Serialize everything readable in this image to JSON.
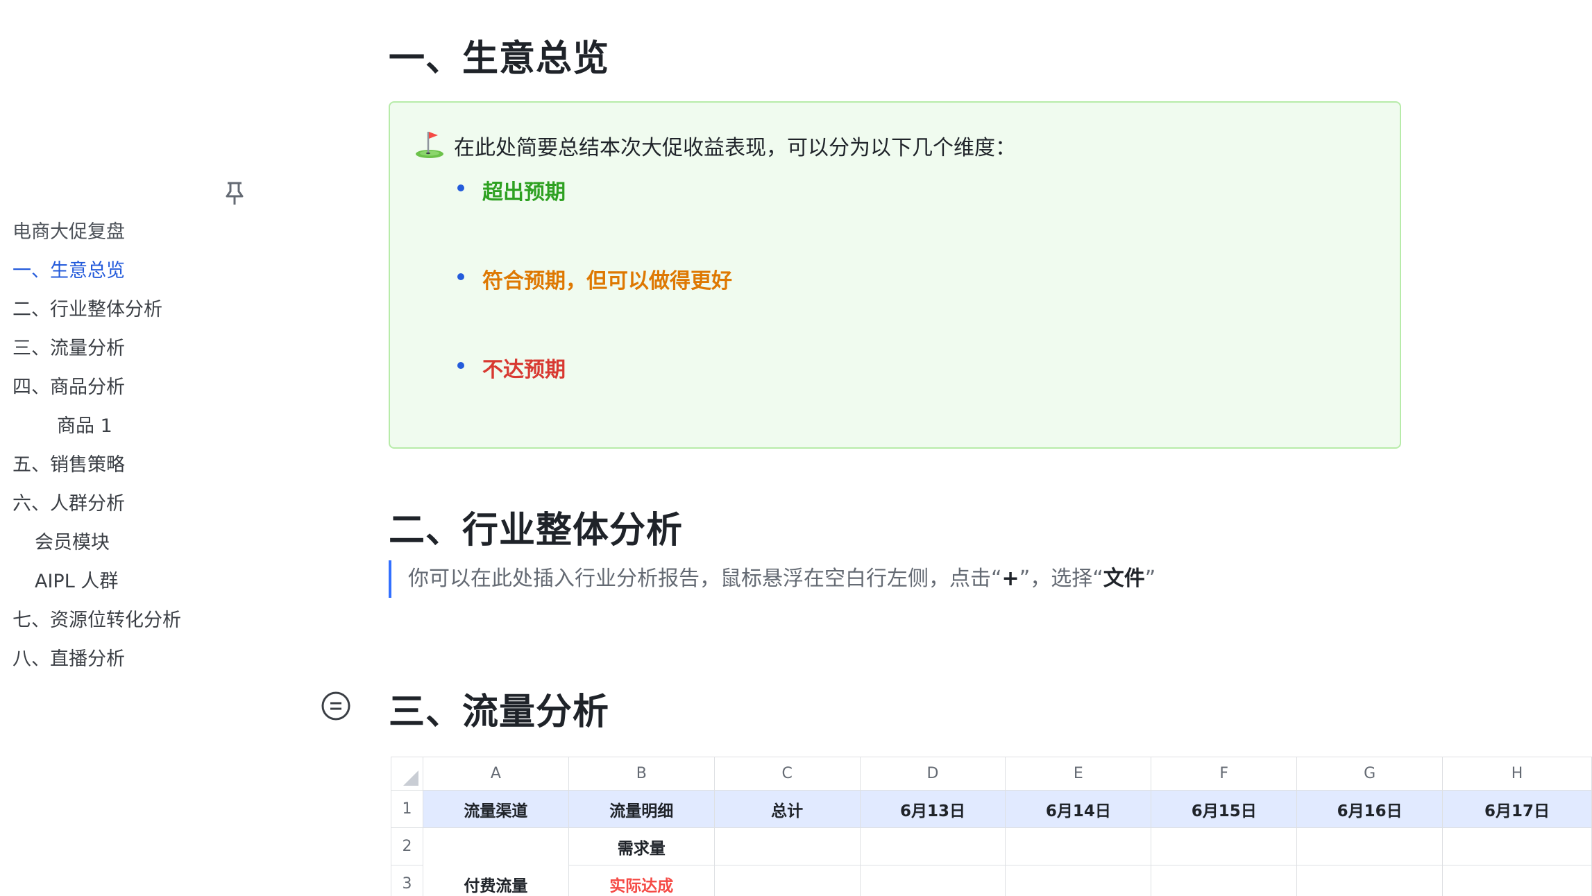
{
  "sidebar": {
    "items": [
      {
        "label": "电商大促复盘",
        "level": 0,
        "kind": "title"
      },
      {
        "label": "一、生意总览",
        "level": 0,
        "kind": "active"
      },
      {
        "label": "二、行业整体分析",
        "level": 0,
        "kind": "normal"
      },
      {
        "label": "三、流量分析",
        "level": 0,
        "kind": "normal"
      },
      {
        "label": "四、商品分析",
        "level": 0,
        "kind": "normal"
      },
      {
        "label": "商品 1",
        "level": 2,
        "kind": "normal"
      },
      {
        "label": "五、销售策略",
        "level": 0,
        "kind": "normal"
      },
      {
        "label": "六、人群分析",
        "level": 0,
        "kind": "normal"
      },
      {
        "label": "会员模块",
        "level": 1,
        "kind": "normal"
      },
      {
        "label": "AIPL 人群",
        "level": 1,
        "kind": "normal"
      },
      {
        "label": "七、资源位转化分析",
        "level": 0,
        "kind": "normal"
      },
      {
        "label": "八、直播分析",
        "level": 0,
        "kind": "normal"
      }
    ],
    "pin_icon": "pin-icon"
  },
  "sections": {
    "s1_title": "一、生意总览",
    "s2_title": "二、行业整体分析",
    "s3_title": "三、流量分析"
  },
  "callout": {
    "icon": "golf-flag-icon",
    "text": "在此处简要总结本次大促收益表现，可以分为以下几个维度：",
    "bullets": [
      {
        "label": "超出预期",
        "color": "#2ea121"
      },
      {
        "label": "符合预期，但可以做得更好",
        "color": "#de7802"
      },
      {
        "label": "不达预期",
        "color": "#d83931"
      }
    ]
  },
  "quote": {
    "pre": "你可以在此处插入行业分析报告，鼠标悬浮在空白行左侧，点击“",
    "plus": "+",
    "mid": "”，选择“",
    "file": "文件",
    "post": "”"
  },
  "sheet": {
    "columns": [
      "A",
      "B",
      "C",
      "D",
      "E",
      "F",
      "G",
      "H"
    ],
    "rows": [
      {
        "num": "1",
        "cells": [
          "流量渠道",
          "流量明细",
          "总计",
          "6月13日",
          "6月14日",
          "6月15日",
          "6月16日",
          "6月17日"
        ]
      },
      {
        "num": "2",
        "cells": [
          "",
          "需求量",
          "",
          "",
          "",
          "",
          "",
          ""
        ]
      },
      {
        "num": "3",
        "cells": [
          "付费流量",
          "实际达成",
          "",
          "",
          "",
          "",
          "",
          ""
        ]
      }
    ]
  }
}
